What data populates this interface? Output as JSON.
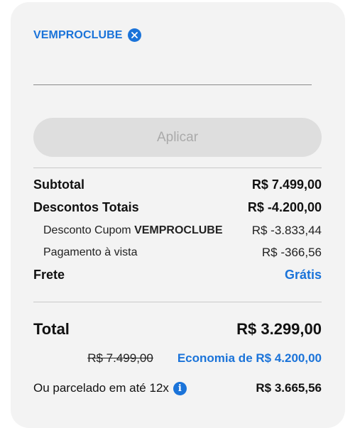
{
  "coupon": {
    "code": "VEMPROCLUBE",
    "remove_icon": "close-icon",
    "input_value": "",
    "input_placeholder": ""
  },
  "apply_button": {
    "label": "Aplicar"
  },
  "summary": {
    "subtotal_label": "Subtotal",
    "subtotal_value": "R$ 7.499,00",
    "discounts_label": "Descontos Totais",
    "discounts_value": "R$ -4.200,00",
    "coupon_discount_prefix": "Desconto Cupom",
    "coupon_discount_code": "VEMPROCLUBE",
    "coupon_discount_value": "R$ -3.833,44",
    "cash_payment_label": "Pagamento à vista",
    "cash_payment_value": "R$ -366,56",
    "shipping_label": "Frete",
    "shipping_value": "Grátis"
  },
  "total": {
    "label": "Total",
    "value": "R$ 3.299,00",
    "original_price": "R$ 7.499,00",
    "savings_text": "Economia de R$ 4.200,00",
    "installment_label": "Ou parcelado em até 12x",
    "installment_value": "R$ 3.665,56",
    "info_icon": "info-icon"
  },
  "colors": {
    "accent": "#1a73d9",
    "card_bg": "#f3f3f3",
    "button_disabled": "#dedede"
  }
}
